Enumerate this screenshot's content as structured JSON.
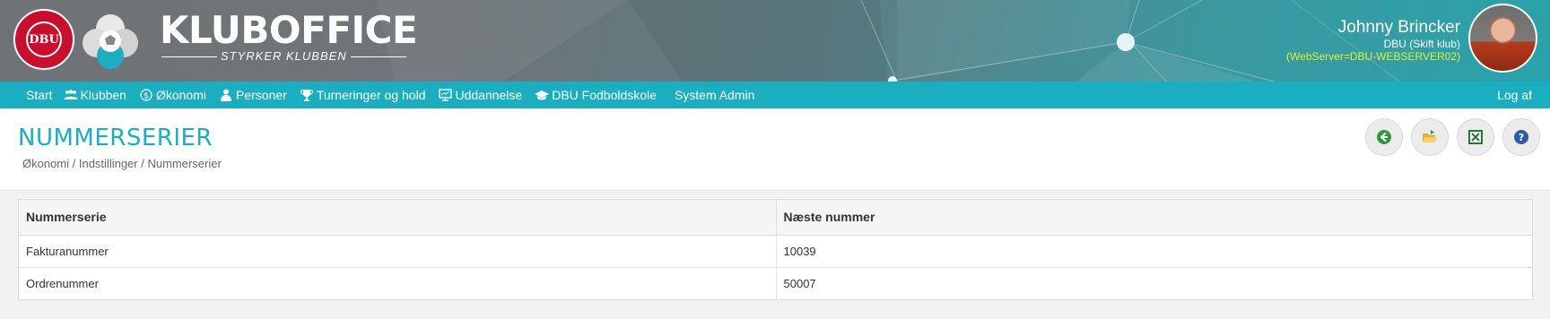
{
  "app": {
    "brand_title": "KLUBOFFICE",
    "brand_subtitle": "STYRKER KLUBBEN",
    "dbu_logo_text": "DBU"
  },
  "user": {
    "name": "Johnny Brincker",
    "club": "DBU (Skift klub)",
    "server": "(WebServer=DBU-WEBSERVER02)"
  },
  "nav": {
    "items": [
      {
        "label": "Start",
        "icon": ""
      },
      {
        "label": "Klubben",
        "icon": "people-icon"
      },
      {
        "label": "Økonomi",
        "icon": "money-icon"
      },
      {
        "label": "Personer",
        "icon": "person-icon"
      },
      {
        "label": "Turneringer og hold",
        "icon": "trophy-icon"
      },
      {
        "label": "Uddannelse",
        "icon": "presentation-icon"
      },
      {
        "label": "DBU Fodboldskole",
        "icon": "graduation-cap-icon"
      },
      {
        "label": "System Admin",
        "icon": ""
      }
    ],
    "logout": "Log af"
  },
  "page": {
    "title": "NUMMERSERIER",
    "breadcrumb": "Økonomi / Indstillinger / Nummerserier"
  },
  "toolbar": [
    {
      "name": "back-button",
      "icon": "back-arrow-icon"
    },
    {
      "name": "open-folder-button",
      "icon": "folder-icon"
    },
    {
      "name": "excel-export-button",
      "icon": "excel-icon"
    },
    {
      "name": "help-button",
      "icon": "help-icon"
    }
  ],
  "table": {
    "headers": [
      "Nummerserie",
      "Næste nummer"
    ],
    "rows": [
      [
        "Fakturanummer",
        "10039"
      ],
      [
        "Ordrenummer",
        "50007"
      ]
    ]
  },
  "colors": {
    "accent": "#1aaec0",
    "server_text": "#e2f02a",
    "dbu_red": "#c8102e"
  }
}
